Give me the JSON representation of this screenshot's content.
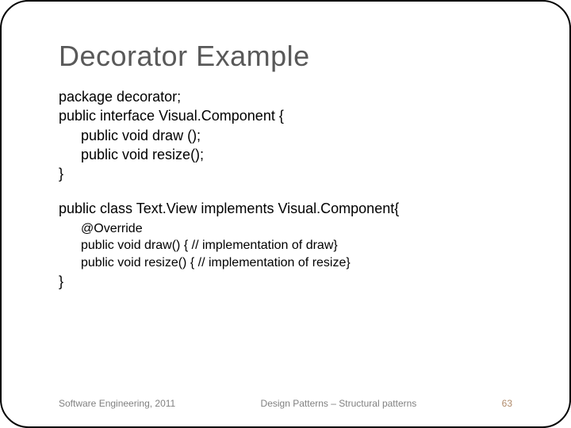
{
  "title": "Decorator Example",
  "code1": {
    "l1": "package decorator;",
    "l2": "public  interface Visual.Component  {",
    "l3": "public void draw ();",
    "l4": "public void resize();",
    "l5": "}"
  },
  "code2": {
    "l1": "public class Text.View  implements Visual.Component{",
    "l2": "@Override",
    "l3": "public void draw() { // implementation of draw}",
    "l4": "public void resize() { // implementation of resize}",
    "l5": "}"
  },
  "footer": {
    "left": "Software Engineering, 2011",
    "center": "Design Patterns – Structural patterns",
    "right": "63"
  }
}
